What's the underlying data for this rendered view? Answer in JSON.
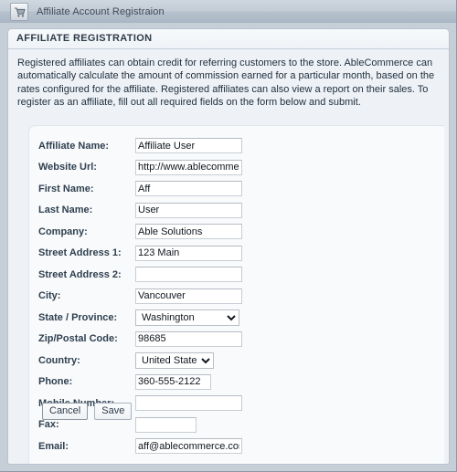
{
  "window": {
    "tab_title": "Affiliate Account Registraion",
    "tab_icon": "shopping-cart-icon"
  },
  "section": {
    "title": "AFFILIATE REGISTRATION",
    "intro": "Registered affiliates can obtain credit for referring customers to the store. AbleCommerce can automatically calculate the amount of commission earned for a particular month, based on the rates configured for the affiliate. Registered affiliates can also view a report on their sales. To register as an affiliate, fill out all required fields on the form below and submit."
  },
  "form": {
    "fields": [
      {
        "label": "Affiliate Name:",
        "value": "Affiliate User",
        "placeholder": "",
        "type": "text"
      },
      {
        "label": "Website Url:",
        "value": "http://www.ablecommerce.com",
        "placeholder": "",
        "type": "text"
      },
      {
        "label": "First Name:",
        "value": "Aff",
        "placeholder": "",
        "type": "text"
      },
      {
        "label": "Last Name:",
        "value": "User",
        "placeholder": "",
        "type": "text"
      },
      {
        "label": "Company:",
        "value": "Able Solutions",
        "placeholder": "",
        "type": "text"
      },
      {
        "label": "Street Address 1:",
        "value": "123 Main",
        "placeholder": "",
        "type": "text"
      },
      {
        "label": "Street Address 2:",
        "value": "",
        "placeholder": "",
        "type": "text"
      },
      {
        "label": "City:",
        "value": "Vancouver",
        "placeholder": "",
        "type": "text"
      },
      {
        "label": "State / Province:",
        "value": "Washington",
        "placeholder": "",
        "type": "select"
      },
      {
        "label": " Zip/Postal Code:",
        "value": "98685",
        "placeholder": "",
        "type": "text"
      },
      {
        "label": "Country:",
        "value": "United States",
        "placeholder": "",
        "type": "select"
      },
      {
        "label": "Phone:",
        "value": "360-555-2122",
        "placeholder": "",
        "type": "text"
      },
      {
        "label": "Mobile Number:",
        "value": "",
        "placeholder": "",
        "type": "text"
      },
      {
        "label": "Fax:",
        "value": "",
        "placeholder": "",
        "type": "text"
      },
      {
        "label": "Email:",
        "value": "aff@ablecommerce.com",
        "placeholder": "",
        "type": "text"
      }
    ],
    "state_options": [
      "Washington"
    ],
    "country_options": [
      "United States"
    ]
  },
  "actions": {
    "cancel_label": "Cancel",
    "save_label": "Save"
  },
  "colors": {
    "chrome": "#c6ced8",
    "card_bg": "#eef2f6",
    "panel_bg": "#f8fafc",
    "label_text": "#30404f",
    "title_text": "#2f3b49"
  }
}
